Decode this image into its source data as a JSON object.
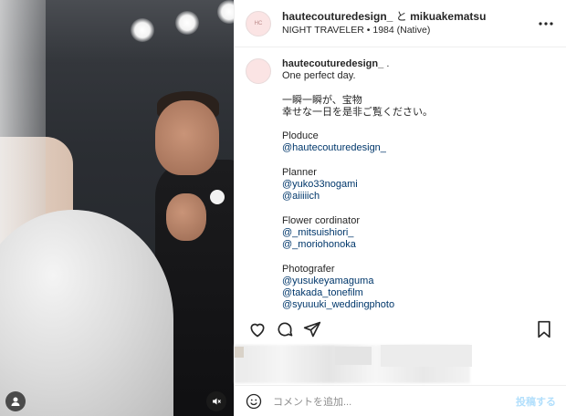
{
  "header": {
    "user1": "hautecouturedesign_",
    "joiner": "と",
    "user2": "mikuakematsu",
    "audio": "NIGHT TRAVELER • 1984 (Native)"
  },
  "caption": {
    "username": "hautecouturedesign_",
    "dot": ".",
    "line1": "One perfect day.",
    "line2": "一瞬一瞬が、宝物",
    "line3": "幸せな一日を是非ご覧ください。",
    "sections": [
      {
        "title": "Ploduce",
        "links": [
          "@hautecouturedesign_"
        ]
      },
      {
        "title": "Planner",
        "links": [
          "@yuko33nogami",
          "@aiiiiich"
        ]
      },
      {
        "title": "Flower cordinator",
        "links": [
          "@_mitsuishiori_",
          "@_moriohonoka"
        ]
      },
      {
        "title": "Photografer",
        "links": [
          "@yusukeyamaguma",
          "@takada_tonefilm",
          "@syuuuki_weddingphoto"
        ]
      }
    ]
  },
  "comment": {
    "placeholder": "コメントを追加...",
    "post": "投稿する"
  },
  "icons": {
    "heart": "heart-icon",
    "comment": "comment-icon",
    "share": "share-icon",
    "save": "bookmark-icon",
    "emoji": "emoji-icon",
    "more": "more-icon",
    "user": "user-tag-icon",
    "mute": "mute-icon"
  }
}
